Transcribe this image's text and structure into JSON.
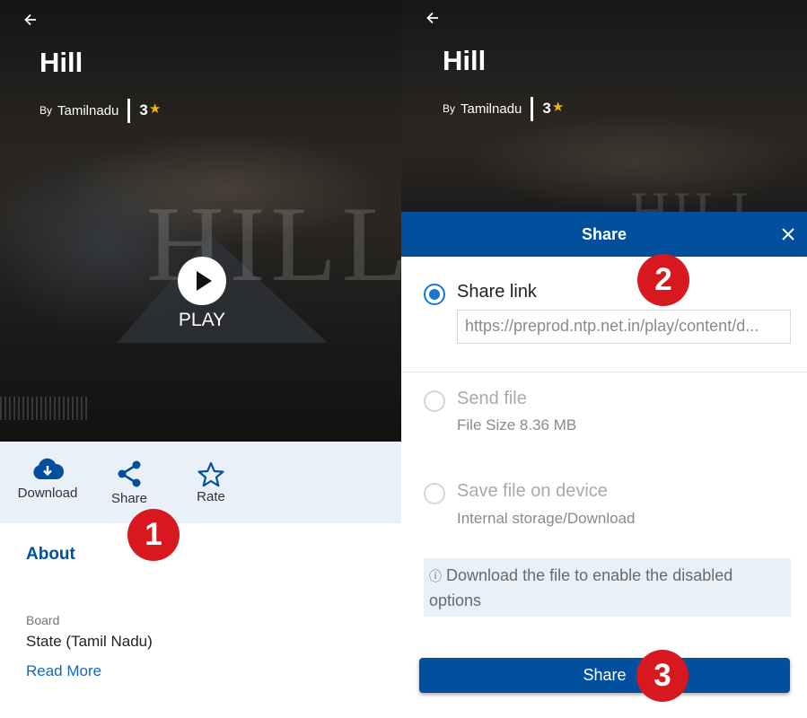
{
  "left_screen": {
    "title": "Hill",
    "by_label": "By",
    "author": "Tamilnadu",
    "rating": "3",
    "rating_star": "★",
    "watermark_text": "HILL",
    "play_label": "PLAY",
    "actions": [
      {
        "label": "Download",
        "icon": "cloud-download-icon"
      },
      {
        "label": "Share",
        "icon": "share-icon"
      },
      {
        "label": "Rate",
        "icon": "star-outline-icon"
      }
    ],
    "about_heading": "About",
    "board_label": "Board",
    "board_value": "State (Tamil Nadu)",
    "read_more": "Read More",
    "step_badge": "1"
  },
  "right_screen": {
    "title": "Hill",
    "by_label": "By",
    "author": "Tamilnadu",
    "rating": "3",
    "rating_star": "★",
    "modal": {
      "title": "Share",
      "options": [
        {
          "label": "Share link",
          "selected": true,
          "enabled": true
        },
        {
          "label": "Send file",
          "sub": "File Size 8.36 MB",
          "selected": false,
          "enabled": false
        },
        {
          "label": "Save file on device",
          "sub": "Internal storage/Download",
          "selected": false,
          "enabled": false
        }
      ],
      "share_link_value": "https://preprod.ntp.net.in/play/content/d...",
      "info_icon": "ⓘ",
      "info_text": "Download the file to enable the disabled options",
      "share_button": "Share"
    },
    "step_badges": [
      "2",
      "3"
    ]
  },
  "colors": {
    "primary_blue": "#024f9d",
    "action_bar_bg": "#e9f0f8",
    "link_blue": "#1466c0",
    "radio_blue": "#1976d2",
    "star_gold": "#f5b400",
    "badge_red": "#d7181f"
  }
}
